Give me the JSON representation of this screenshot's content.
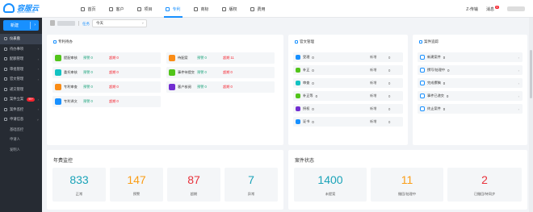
{
  "app": {
    "logo_text": "容服云",
    "logo_sub": "rfy114.com.cn"
  },
  "nav": [
    {
      "label": "首页",
      "icon": "home-icon"
    },
    {
      "label": "客户",
      "icon": "customer-icon"
    },
    {
      "label": "项目",
      "icon": "project-icon"
    },
    {
      "label": "专利",
      "icon": "patent-icon",
      "active": true
    },
    {
      "label": "商标",
      "icon": "trademark-icon"
    },
    {
      "label": "版权",
      "icon": "copyright-icon"
    },
    {
      "label": "费用",
      "icon": "fee-icon"
    }
  ],
  "topright": {
    "transfer": "Z-传输",
    "messages": "消息",
    "message_count": "6"
  },
  "sidebar": {
    "new_button": "新建",
    "items": [
      {
        "label": "仪表盘",
        "active": true
      },
      {
        "label": "待办事项",
        "chevron": true
      },
      {
        "label": "配额管理",
        "chevron": true
      },
      {
        "label": "审批管理",
        "chevron": true
      },
      {
        "label": "官文管理",
        "chevron": true
      },
      {
        "label": "递交管理"
      },
      {
        "label": "案件立案",
        "badge": "99+"
      },
      {
        "label": "案件监控",
        "chevron": true
      },
      {
        "label": "申请信息",
        "chevron": true
      },
      {
        "label": "基础监控",
        "sub": true
      },
      {
        "label": "申请人",
        "sub": true
      },
      {
        "label": "发明人",
        "sub": true
      }
    ]
  },
  "filter": {
    "label": "任务",
    "select_value": "今天"
  },
  "tasks": {
    "title": "专利待办",
    "items": [
      {
        "label": "提配审核",
        "warn": "预警 0",
        "over": "超期 0",
        "color": "#52c41a"
      },
      {
        "label": "待配案",
        "warn": "预警 0",
        "over": "超期 11",
        "color": "#fa8c16"
      },
      {
        "label": "委托审核",
        "warn": "预警 0",
        "over": "超期 0",
        "color": "#13c2c2"
      },
      {
        "label": "事件待提交",
        "warn": "预警 0",
        "over": "超期 0",
        "color": "#52c41a"
      },
      {
        "label": "专利审查",
        "warn": "预警 0",
        "over": "超期 0",
        "color": "#fa8c16"
      },
      {
        "label": "客户核阅",
        "warn": "预警 0",
        "over": "超期 0",
        "color": "#722ed1"
      },
      {
        "label": "专利译文",
        "warn": "预警 0",
        "over": "超期 0",
        "color": "#1890ff"
      }
    ]
  },
  "official": {
    "title": "官文管理",
    "items": [
      {
        "label": "受理",
        "value": "0",
        "tag": "新增",
        "count": "0",
        "color": "#1890ff"
      },
      {
        "label": "补正",
        "value": "0",
        "tag": "新增",
        "count": "0",
        "color": "#52c41a"
      },
      {
        "label": "审查",
        "value": "0",
        "tag": "新增",
        "count": "0",
        "color": "#13c2c2"
      },
      {
        "label": "补正等",
        "value": "0",
        "tag": "新增",
        "count": "0",
        "color": "#52c41a"
      },
      {
        "label": "授权",
        "value": "0",
        "tag": "新增",
        "count": "0",
        "color": "#722ed1"
      },
      {
        "label": "证书",
        "value": "0",
        "tag": "新增",
        "count": "0",
        "color": "#1890ff"
      }
    ]
  },
  "cases": {
    "title": "案件追踪",
    "items": [
      {
        "label": "新建案件",
        "value": "0"
      },
      {
        "label": "撰写/处理中",
        "value": "0"
      },
      {
        "label": "完成撰稿",
        "value": "0"
      },
      {
        "label": "事件已递交",
        "value": "0"
      },
      {
        "label": "终止案件",
        "value": "0"
      }
    ]
  },
  "annual": {
    "title": "年费监控",
    "cards": [
      {
        "value": "833",
        "label": "正常",
        "color": "#1aa3b8"
      },
      {
        "value": "147",
        "label": "预警",
        "color": "#fa9d16"
      },
      {
        "value": "87",
        "label": "超期",
        "color": "#e8323c"
      },
      {
        "value": "7",
        "label": "异常",
        "color": "#1aa3b8"
      }
    ]
  },
  "case_status": {
    "title": "案件状态",
    "cards": [
      {
        "value": "1400",
        "label": "未提案",
        "color": "#1aa3b8"
      },
      {
        "value": "11",
        "label": "撤回/处理中",
        "color": "#fa9d16"
      },
      {
        "value": "2",
        "label": "已撤回/待同步",
        "color": "#e8323c"
      }
    ]
  }
}
